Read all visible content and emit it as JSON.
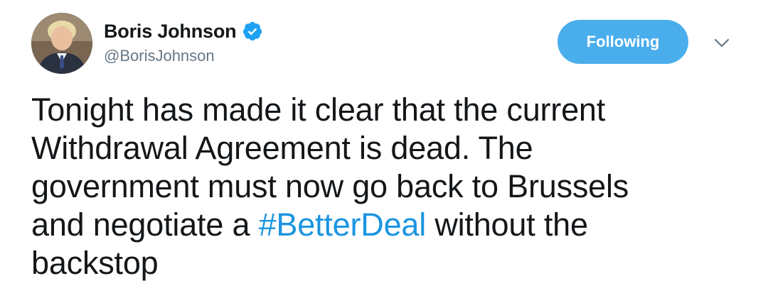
{
  "author": {
    "display_name": "Boris Johnson",
    "handle": "@BorisJohnson",
    "verified": true
  },
  "follow_button": {
    "label": "Following"
  },
  "tweet": {
    "text_line_1": "Tonight has made it clear that the current",
    "text_line_2": "Withdrawal Agreement is dead. The",
    "text_line_3": "government must now go back to Brussels",
    "text_line_4_before": "and negotiate a ",
    "hashtag": "#BetterDeal",
    "text_line_4_after": " without the",
    "text_line_5": "backstop"
  },
  "colors": {
    "follow_button_bg": "#4aaeec",
    "hashtag": "#1b95e0",
    "verified_badge": "#1da1f2",
    "handle_text": "#657786"
  },
  "icons": {
    "verified": "verified-badge-icon",
    "more": "chevron-down-icon"
  }
}
